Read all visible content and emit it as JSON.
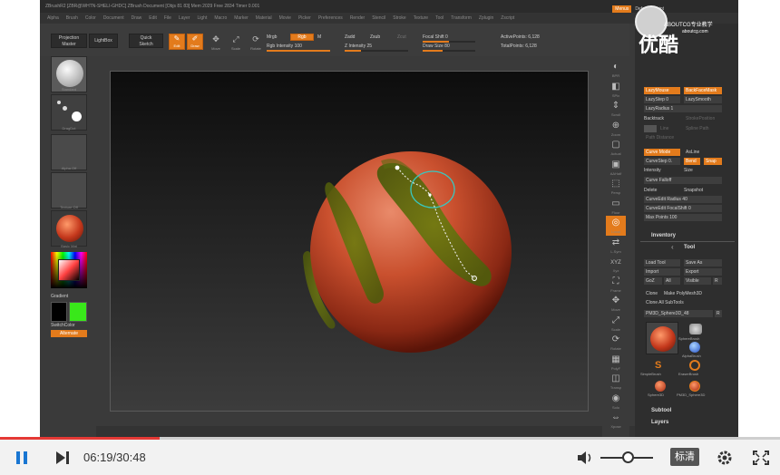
{
  "app": {
    "title": "ZBrushR2  [ZBR@WHTN-SHELI-GHDC]   ZBrush Document     [Objs 81 83]  Mem 2029 Free 2834 Timer 0.001",
    "menu_btn": "Menus",
    "script": "DefaultZScript"
  },
  "menu": [
    "Alpha",
    "Brush",
    "Color",
    "Document",
    "Draw",
    "Edit",
    "File",
    "Layer",
    "Light",
    "Macro",
    "Marker",
    "Material",
    "Movie",
    "Picker",
    "Preferences",
    "Render",
    "Stencil",
    "Stroke",
    "Texture",
    "Tool",
    "Transform",
    "Zplugin",
    "Zscript"
  ],
  "shelf": {
    "projection_master": "Projection\nMaster",
    "lightbox": "LightBox",
    "quick_sketch": "Quick\nSketch",
    "edit": "Edit",
    "draw": "Draw",
    "move": "Move",
    "scale": "Scale",
    "rotate": "Rotate",
    "mrgb": "Mrgb",
    "rgb": "Rgb",
    "m": "M",
    "rgb_intensity": "Rgb Intensity 100",
    "zadd": "Zadd",
    "zsub": "Zsub",
    "zcut": "Zcut",
    "z_intensity": "Z Intensity 25",
    "focal_shift": "Focal Shift 0",
    "draw_size": "Draw Size 80",
    "active_points": "ActivePoints: 6,128",
    "total_points": "TotalPoints: 6,128"
  },
  "left": {
    "thumb_labels": [
      "Standard",
      "DragDot",
      "Alpha Off",
      "Texture Off",
      "Basic Mat"
    ],
    "gradient": "Gradient",
    "switch_color": "SwitchColor",
    "alternate": "Alternate"
  },
  "right_icons": [
    "BPR",
    "SPix",
    "Scroll",
    "Zoom",
    "Actual",
    "AAHalf",
    "Persp",
    "Floor",
    "Local",
    "L.Sym",
    "Xyz",
    "Frame",
    "Move",
    "Scale",
    "Rotate",
    "PolyF",
    "Transp",
    "Solo",
    "Xpose"
  ],
  "rpanel": {
    "lazy_mouse": "LazyMouse",
    "backfacemask": "BackFaceMask",
    "lazy_step": "LazyStep 0",
    "lazy_smooth": "LazySmooth",
    "lazy_radius": "LazyRadius 1",
    "backtrack": "Backtrack",
    "stroke_pos": "StrokePosition",
    "line": "Line",
    "spline_path": "Spline Path",
    "path_distance": "Path Distance",
    "curve_mode": "Curve Mode",
    "asline": "AsLine",
    "curve_step": "CurveStep 0.",
    "bend": "Bend",
    "snap": "Snap",
    "intensity": "Intensity",
    "size": "Size",
    "curve_falloff": "Curve Falloff",
    "delete": "Delete",
    "snapshot": "Snapshot",
    "curve_edit_radius": "CurveEdit Radius 40",
    "curve_edit_focal": "CurveEdit FocalShift 0",
    "max_points": "Max Points 100",
    "inventory": "Inventory",
    "tool": "Tool",
    "load_tool": "Load Tool",
    "save_as": "Save As",
    "import": "Import",
    "export": "Export",
    "goz": "GoZ",
    "all": "All",
    "visible": "Visible",
    "r": "R",
    "clone": "Clone",
    "make_polymesh": "Make PolyMesh3D",
    "clone_all": "Clone All SubTools",
    "pm3d": "PM3D_Sphere3D_48",
    "r2": "R",
    "tool_labels": [
      "SphereBrush",
      "AlphaBrush",
      "SimpleBrush",
      "EraserBrush",
      "Sphere3D",
      "PM3D_Sphere3D"
    ],
    "subtool": "Subtool",
    "layers": "Layers"
  },
  "watermark": {
    "text": "ABOUTCG专业教学",
    "url": "aboutcg.com",
    "big": "优酷"
  },
  "player": {
    "current_time": "06:19",
    "total_time": "30:48",
    "time_display": "06:19/30:48",
    "quality": "标清",
    "progress_fraction": 0.205,
    "volume_fraction": 0.45
  },
  "colors": {
    "accent": "#e37b1c",
    "progress": "#e53935"
  }
}
